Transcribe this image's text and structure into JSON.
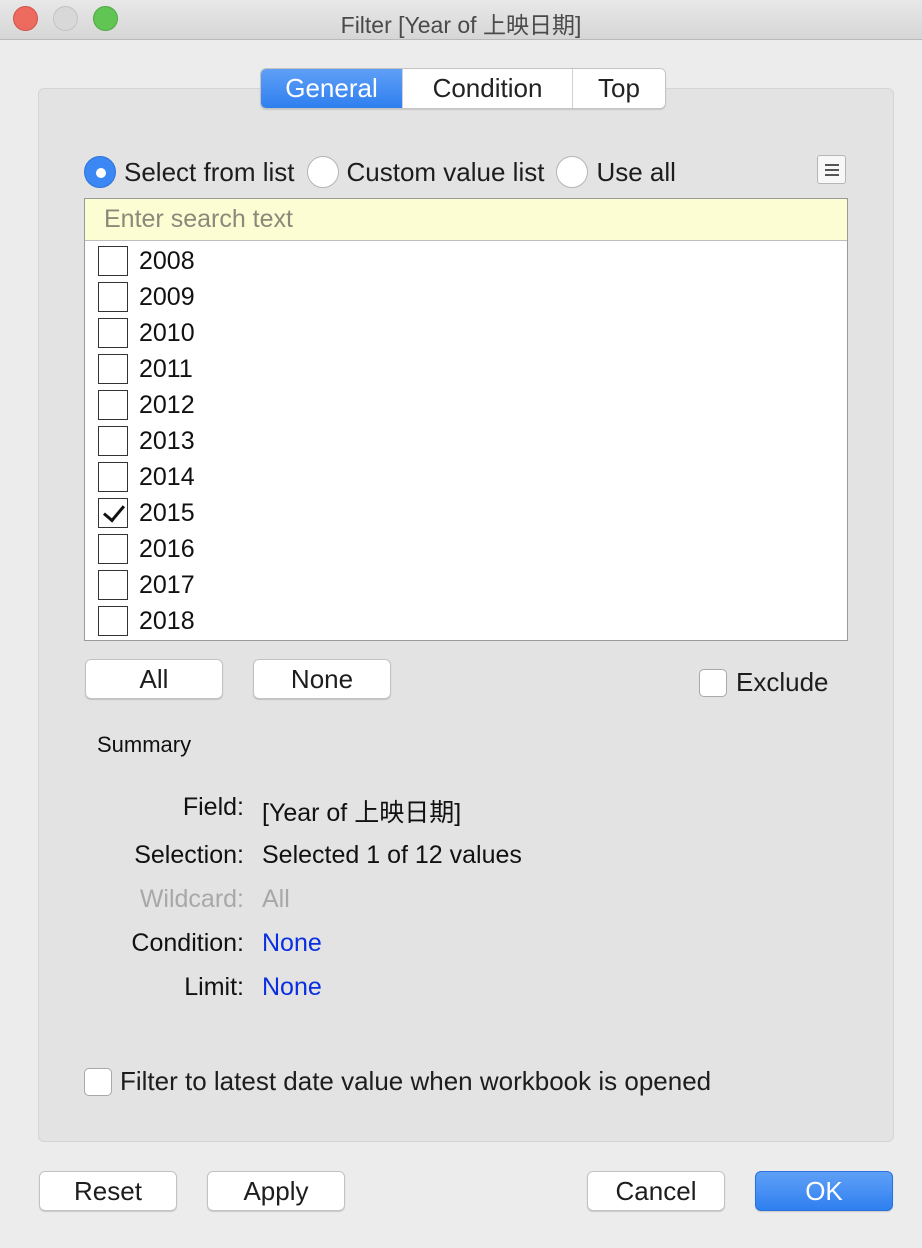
{
  "window": {
    "title": "Filter [Year of 上映日期]"
  },
  "tabs": [
    {
      "label": "General",
      "active": true
    },
    {
      "label": "Condition",
      "active": false
    },
    {
      "label": "Top",
      "active": false
    }
  ],
  "mode": {
    "options": [
      {
        "label": "Select from list",
        "selected": true
      },
      {
        "label": "Custom value list",
        "selected": false
      },
      {
        "label": "Use all",
        "selected": false
      }
    ]
  },
  "search": {
    "placeholder": "Enter search text",
    "value": ""
  },
  "list": {
    "items": [
      {
        "label": "2008",
        "checked": false
      },
      {
        "label": "2009",
        "checked": false
      },
      {
        "label": "2010",
        "checked": false
      },
      {
        "label": "2011",
        "checked": false
      },
      {
        "label": "2012",
        "checked": false
      },
      {
        "label": "2013",
        "checked": false
      },
      {
        "label": "2014",
        "checked": false
      },
      {
        "label": "2015",
        "checked": true
      },
      {
        "label": "2016",
        "checked": false
      },
      {
        "label": "2017",
        "checked": false
      },
      {
        "label": "2018",
        "checked": false
      }
    ]
  },
  "list_buttons": {
    "all_label": "All",
    "none_label": "None"
  },
  "exclude": {
    "label": "Exclude",
    "checked": false
  },
  "summary": {
    "title": "Summary",
    "rows": [
      {
        "label": "Field:",
        "value": "[Year of 上映日期]"
      },
      {
        "label": "Selection:",
        "value": "Selected 1 of 12 values"
      },
      {
        "label": "Wildcard:",
        "value": "All"
      },
      {
        "label": "Condition:",
        "value": "None"
      },
      {
        "label": "Limit:",
        "value": "None"
      }
    ]
  },
  "latest_date": {
    "label": "Filter to latest date value when workbook is opened",
    "checked": false
  },
  "footer": {
    "reset_label": "Reset",
    "apply_label": "Apply",
    "cancel_label": "Cancel",
    "ok_label": "OK"
  },
  "colors": {
    "accent": "#3b87f3",
    "link": "#0a2fe0",
    "search_bg": "#fdfdd4",
    "disabled_text": "#a8a8a8"
  },
  "icons": [
    "close-icon",
    "minimize-icon",
    "maximize-icon",
    "list-menu-icon",
    "checkmark-icon"
  ]
}
